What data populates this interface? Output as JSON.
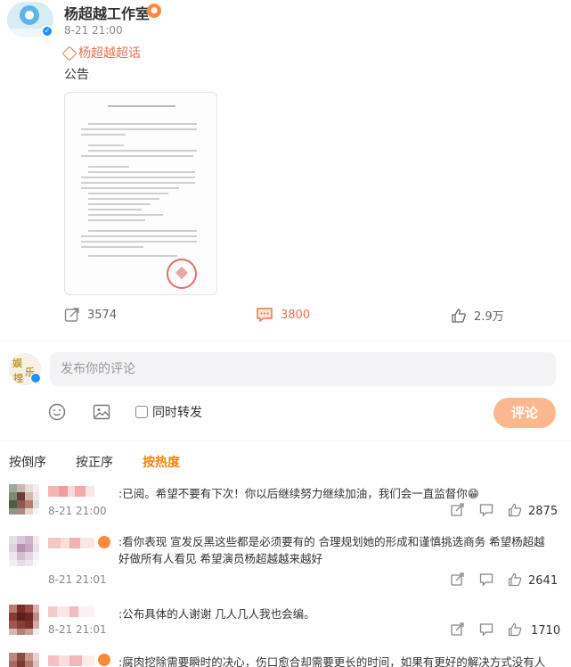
{
  "post": {
    "author": "杨超越工作室",
    "time": "8-21 21:00",
    "topic": "杨超越超话",
    "text": "公告",
    "image_alt_title": "杨超越工作室公告"
  },
  "actions": {
    "repost_count": "3574",
    "comment_count": "3800",
    "like_count": "2.9万"
  },
  "composer": {
    "placeholder": "发布你的评论",
    "repost_label": "同时转发",
    "submit_label": "评论"
  },
  "sort": {
    "items": [
      "按倒序",
      "按正序",
      "按热度"
    ],
    "active": "按热度"
  },
  "comments": [
    {
      "text": ":已阅。希望不要有下次！你以后继续努力继续加油，我们会一直监督你😁",
      "time": "8-21 21:00",
      "likes": "2875"
    },
    {
      "text": ":看你表现 宣发反黑这些都是必须要有的 合理规划她的形成和谨慎挑选商务 希望杨超越好做所有人看见 希望演员杨超越越来越好",
      "time": "8-21 21:01",
      "likes": "2641"
    },
    {
      "text": ":公布具体的人谢谢 几人几人我也会编。",
      "time": "8-21 21:01",
      "likes": "1710"
    },
    {
      "text": ":腐肉挖除需要瞬时的决心，伤口愈合却需要更长的时间，如果有更好的解决方式没有人"
    }
  ],
  "colors": {
    "accent": "#ff8200",
    "link": "#eb7350",
    "verify": "#1e90ff"
  }
}
